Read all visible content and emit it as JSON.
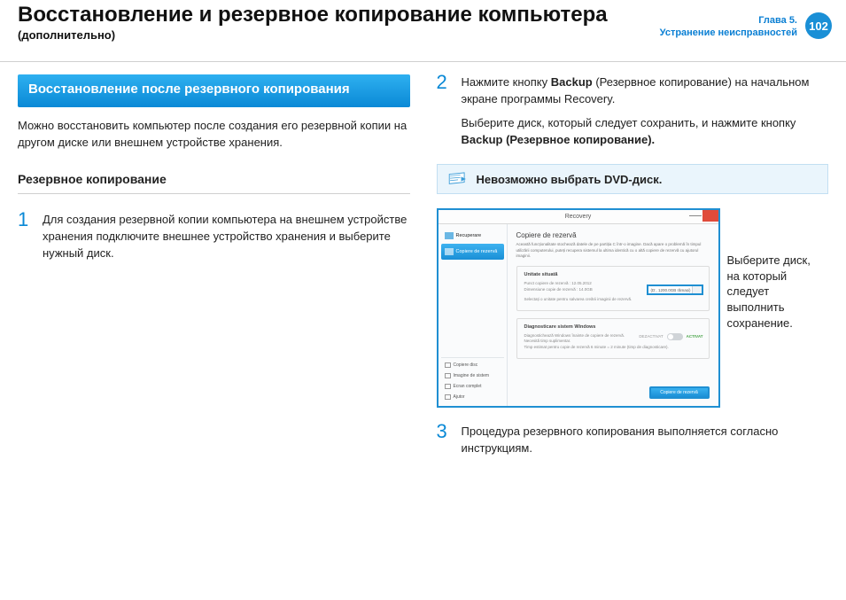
{
  "header": {
    "title": "Восстановление и резервное копирование компьютера",
    "subtitle": "(дополнительно)",
    "chapter_line1": "Глава 5.",
    "chapter_line2": "Устранение неисправностей",
    "page_num": "102"
  },
  "section": {
    "heading": "Восстановление после резервного копирования",
    "intro": "Можно восстановить компьютер после создания его резервной копии на другом диске или внешнем устройстве хранения."
  },
  "backup": {
    "heading": "Резервное копирование",
    "step1": "Для создания резервной копии компьютера на внешнем устройстве хранения подключите внешнее устройство хранения и выберите нужный диск.",
    "step2_a": "Нажмите кнопку ",
    "step2_b": "Backup",
    "step2_c": " (Резервное копирование) на начальном экране программы Recovery.",
    "step2_d": "Выберите диск, который следует сохранить, и нажмите кнопку ",
    "step2_e": "Backup (Резервное копирование).",
    "note": "Невозможно выбрать DVD-диск.",
    "step3": "Процедура резервного копирования выполняется согласно инструкциям.",
    "callout": "Выберите диск, на который следует выполнить сохранение."
  },
  "shot": {
    "app_title": "Recovery",
    "side_item1": "Recuperare",
    "side_item2": "Copiere de rezervă",
    "side_btn1": "Copiere disc",
    "side_btn2": "Imagine de sistem",
    "side_btn3": "Ecran complet",
    "side_btn4": "Ajutor",
    "main_title": "Copiere de rezervă",
    "main_sub": "Această funcționalitate stochează datele de pe partiția C într-o imagine. Dacă apare o problemă în timpul utilizării computerului, puteți recupera sistemul la ultima identică cu o altă copiere de rezervă cu ajutorul imaginii.",
    "panel1_title": "Unitate situată",
    "panel1_line1": "Punct copiere de rezervă : 12.05.2012",
    "panel1_line2": "Dimensiune copie de rezervă : 14.0GB",
    "panel1_line3": "Selectați o unitate pentru salvarea creării imaginii de rezervă.",
    "disk": "(D:, 1200.0GB rămași)",
    "panel2_title": "Diagnosticare sistem Windows",
    "panel2_line1": "Diagnostichează Windows înainte de copiere de rezervă.",
    "panel2_line2": "Necesită timp suplimentar.",
    "panel2_line3": "Timp estimat pentru copie de rezervă 6 minute = 2 minute (timp de diagnosticare).",
    "toggle_off": "DEZACTIVAT",
    "toggle_on": "ACTIVAT",
    "backup_btn": "Copiere de rezervă"
  }
}
